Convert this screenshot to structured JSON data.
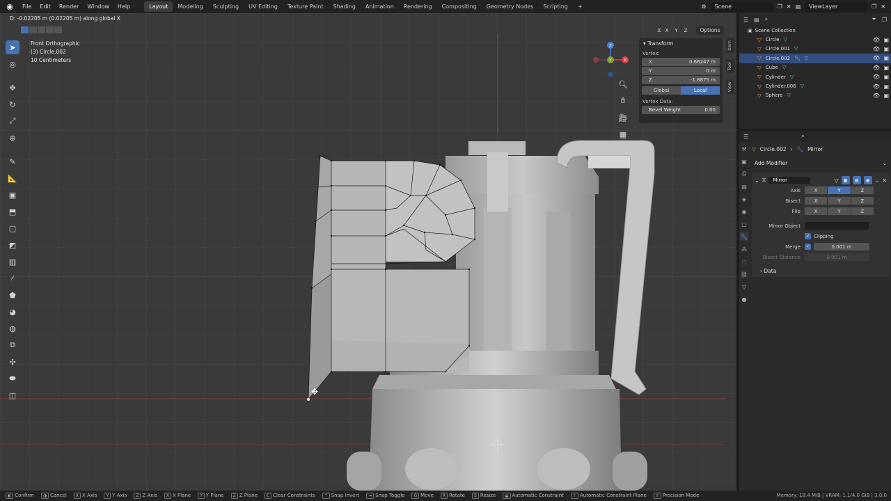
{
  "topbar": {
    "menus": [
      "File",
      "Edit",
      "Render",
      "Window",
      "Help"
    ],
    "workspaces": [
      "Layout",
      "Modeling",
      "Sculpting",
      "UV Editing",
      "Texture Paint",
      "Shading",
      "Animation",
      "Rendering",
      "Compositing",
      "Geometry Nodes",
      "Scripting"
    ],
    "active_workspace": "Layout",
    "add_tab": "+",
    "scene": "Scene",
    "view_layer": "ViewLayer"
  },
  "viewport": {
    "status_message": "D: -0.02205 m (0.02205 m) along global X",
    "view_name": "Front Orthographic",
    "object_name": "(3) Circle.002",
    "scale": "10 Centimeters",
    "xyz": [
      "X",
      "Y",
      "Z"
    ],
    "options_label": "Options",
    "gizmo_axes": [
      "X",
      "Y",
      "Z"
    ]
  },
  "npanel": {
    "title": "Transform",
    "vertex_label": "Vertex:",
    "x_label": "X",
    "x_value": "0.66247 m",
    "y_label": "Y",
    "y_value": "0 m",
    "z_label": "Z",
    "z_value": "-1.8875 m",
    "global_label": "Global",
    "local_label": "Local",
    "vertex_data_label": "Vertex Data:",
    "bevel_label": "Bevel Weight",
    "bevel_value": "0.00",
    "tabs": [
      "Item",
      "Tool",
      "View"
    ]
  },
  "outliner": {
    "collection": "Scene Collection",
    "items": [
      {
        "name": "Circle",
        "selected": false
      },
      {
        "name": "Circle.001",
        "selected": false
      },
      {
        "name": "Circle.002",
        "selected": true
      },
      {
        "name": "Cube",
        "selected": false
      },
      {
        "name": "Cylinder",
        "selected": false
      },
      {
        "name": "Cylinder.006",
        "selected": false
      },
      {
        "name": "Sphere",
        "selected": false
      }
    ]
  },
  "properties": {
    "object": "Circle.002",
    "modifier_crumb": "Mirror",
    "add_modifier": "Add Modifier",
    "modifier_name": "Mirror",
    "axis_label": "Axis",
    "bisect_label": "Bisect",
    "flip_label": "Flip",
    "axes": [
      "X",
      "Y",
      "Z"
    ],
    "mirror_object_label": "Mirror Object",
    "clipping_label": "Clipping",
    "merge_label": "Merge",
    "merge_value": "0.001 m",
    "bisect_distance_label": "Bisect Distance",
    "bisect_distance_value": "0.001 m",
    "data_label": "Data"
  },
  "statusbar": {
    "items": [
      "Confirm",
      "Cancel",
      "X Axis",
      "Y Axis",
      "Z Axis",
      "X Plane",
      "Y Plane",
      "Z Plane",
      "Clear Constraints",
      "Snap Invert",
      "Snap Toggle",
      "Move",
      "Rotate",
      "Resize",
      "Automatic Constraint",
      "Automatic Constraint Plane",
      "Precision Mode"
    ],
    "memory": "Memory: 18.4 MiB | VRAM: 1.1/4.0 GiB | 3.0.0"
  },
  "colors": {
    "accent": "#4772b3",
    "selection_row": "#334d80",
    "object_icon": "#e59a3a",
    "modifier_icon": "#6bd6b0"
  }
}
